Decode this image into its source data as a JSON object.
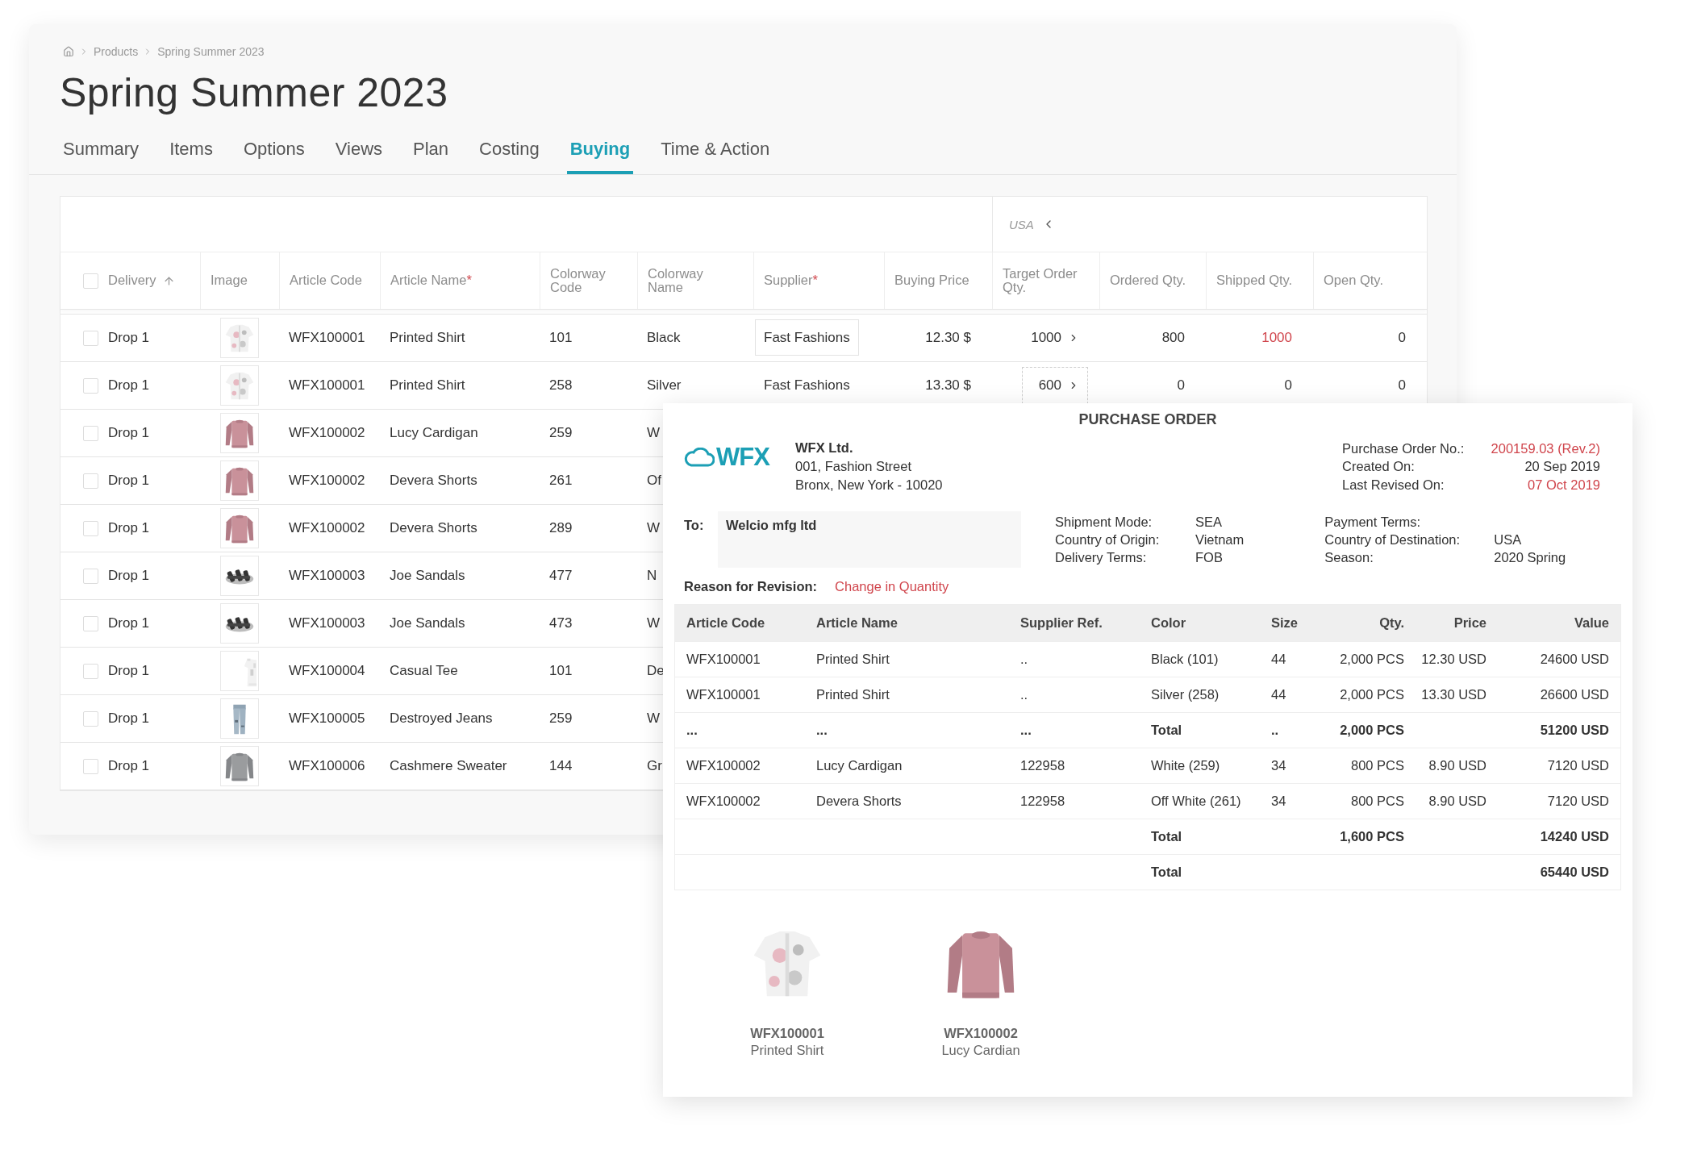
{
  "breadcrumb": [
    "Products",
    "Spring Summer 2023"
  ],
  "title": "Spring Summer 2023",
  "tabs": [
    {
      "label": "Summary",
      "selected": false
    },
    {
      "label": "Items",
      "selected": false
    },
    {
      "label": "Options",
      "selected": false
    },
    {
      "label": "Views",
      "selected": false
    },
    {
      "label": "Plan",
      "selected": false
    },
    {
      "label": "Costing",
      "selected": false
    },
    {
      "label": "Buying",
      "selected": true
    },
    {
      "label": "Time & Action",
      "selected": false
    }
  ],
  "filter": {
    "value": "USA"
  },
  "table": {
    "header_checked": false,
    "columns": [
      {
        "label": "Delivery",
        "sorted": true
      },
      {
        "label": "Image"
      },
      {
        "label": "Article Code"
      },
      {
        "label": "Article Name",
        "required_mark": "*"
      },
      {
        "label": "Colorway Code"
      },
      {
        "label": "Colorway Name"
      },
      {
        "label": "Supplier",
        "required_mark": "*"
      },
      {
        "label": "Buying Price"
      },
      {
        "label": "Target Order Qty."
      },
      {
        "label": "Ordered Qty."
      },
      {
        "label": "Shipped Qty."
      },
      {
        "label": "Open Qty."
      }
    ],
    "rows": [
      {
        "checked": false,
        "delivery": "Drop 1",
        "article_code": "WFX100001",
        "article_name": "Printed Shirt",
        "colorway_code": "101",
        "colorway_name": "Black",
        "supplier": "Fast Fashions",
        "supplier_editing": true,
        "buying_price": "12.30 $",
        "target_qty": "1000",
        "target_expandable": true,
        "target_focused": false,
        "ordered_qty": "800",
        "shipped_qty": "1000",
        "shipped_alert": true,
        "open_qty": "0"
      },
      {
        "checked": false,
        "delivery": "Drop 1",
        "article_code": "WFX100001",
        "article_name": "Printed Shirt",
        "colorway_code": "258",
        "colorway_name": "Silver",
        "supplier": "Fast Fashions",
        "supplier_editing": false,
        "buying_price": "13.30 $",
        "target_qty": "600",
        "target_expandable": true,
        "target_focused": true,
        "ordered_qty": "0",
        "shipped_qty": "0",
        "shipped_alert": false,
        "open_qty": "0"
      },
      {
        "checked": false,
        "delivery": "Drop 1",
        "article_code": "WFX100002",
        "article_name": "Lucy Cardigan",
        "colorway_code": "259",
        "colorway_name": "W"
      },
      {
        "checked": false,
        "delivery": "Drop 1",
        "article_code": "WFX100002",
        "article_name": "Devera Shorts",
        "colorway_code": "261",
        "colorway_name": "Of"
      },
      {
        "checked": false,
        "delivery": "Drop 1",
        "article_code": "WFX100002",
        "article_name": "Devera Shorts",
        "colorway_code": "289",
        "colorway_name": "W"
      },
      {
        "checked": false,
        "delivery": "Drop 1",
        "article_code": "WFX100003",
        "article_name": "Joe Sandals",
        "colorway_code": "477",
        "colorway_name": "N"
      },
      {
        "checked": false,
        "delivery": "Drop 1",
        "article_code": "WFX100003",
        "article_name": "Joe Sandals",
        "colorway_code": "473",
        "colorway_name": "W"
      },
      {
        "checked": false,
        "delivery": "Drop 1",
        "article_code": "WFX100004",
        "article_name": "Casual Tee",
        "colorway_code": "101",
        "colorway_name": "De"
      },
      {
        "checked": false,
        "delivery": "Drop 1",
        "article_code": "WFX100005",
        "article_name": "Destroyed Jeans",
        "colorway_code": "259",
        "colorway_name": "W"
      },
      {
        "checked": false,
        "delivery": "Drop 1",
        "article_code": "WFX100006",
        "article_name": "Cashmere Sweater",
        "colorway_code": "144",
        "colorway_name": "Gr"
      }
    ]
  },
  "purchase_order": {
    "title": "PURCHASE ORDER",
    "logo_text": "WFX",
    "company": {
      "name": "WFX Ltd.",
      "address": [
        "001, Fashion Street",
        "Bronx, New York - 10020"
      ]
    },
    "meta": [
      {
        "label": "Purchase Order No.:",
        "value": "200159.03 (Rev.2)",
        "highlight": true
      },
      {
        "label": "Created On:",
        "value": "20 Sep 2019",
        "highlight": false
      },
      {
        "label": "Last Revised On:",
        "value": "07 Oct 2019",
        "highlight": true
      }
    ],
    "to": {
      "label": "To:",
      "value": "Welcio mfg ltd"
    },
    "shipping": [
      {
        "label": "Shipment Mode:",
        "value": "SEA"
      },
      {
        "label": "Country of Origin:",
        "value": "Vietnam"
      },
      {
        "label": "Delivery Terms:",
        "value": "FOB"
      }
    ],
    "payment": [
      {
        "label": "Payment Terms:"
      },
      {
        "label": "Country of Destination:",
        "value": "USA"
      },
      {
        "label": "Season:",
        "value": "2020 Spring"
      }
    ],
    "revision": {
      "label": "Reason for Revision:",
      "value": "Change in Quantity"
    },
    "columns": [
      "Article Code",
      "Article Name",
      "Supplier Ref.",
      "Color",
      "Size",
      "Qty.",
      "Price",
      "Value"
    ],
    "rows": [
      {
        "kind": "item",
        "code": "WFX100001",
        "name": "Printed Shirt",
        "ref": "..",
        "color_name": "Black (101)",
        "size": "44",
        "qty": "2,000 PCS",
        "price": "12.30 USD",
        "value": "24600 USD"
      },
      {
        "kind": "item",
        "code": "WFX100001",
        "name": "Printed Shirt",
        "ref": "..",
        "color_name": "Silver (258)",
        "size": "44",
        "qty": "2,000 PCS",
        "price": "13.30 USD",
        "value": "26600 USD"
      },
      {
        "kind": "total",
        "code": "...",
        "name": "...",
        "ref": "...",
        "color_name": "Total",
        "size": "..",
        "qty": "2,000 PCS",
        "value": "51200 USD"
      },
      {
        "kind": "item",
        "code": "WFX100002",
        "name": "Lucy Cardigan",
        "ref": "122958",
        "color_name": "White (259)",
        "size": "34",
        "qty": "800 PCS",
        "price": "8.90 USD",
        "value": "7120 USD"
      },
      {
        "kind": "item",
        "code": "WFX100002",
        "name": "Devera Shorts",
        "ref": "122958",
        "color_name": "Off White (261)",
        "size": "34",
        "qty": "800 PCS",
        "price": "8.90 USD",
        "value": "7120 USD"
      },
      {
        "kind": "total",
        "color_name": "Total",
        "qty": "1,600 PCS",
        "value": "14240 USD"
      },
      {
        "kind": "total",
        "color_name": "Total",
        "value": "65440 USD"
      }
    ],
    "products": [
      {
        "code": "WFX100001",
        "name": "Printed Shirt"
      },
      {
        "code": "WFX100002",
        "name": "Lucy Cardian"
      }
    ]
  }
}
